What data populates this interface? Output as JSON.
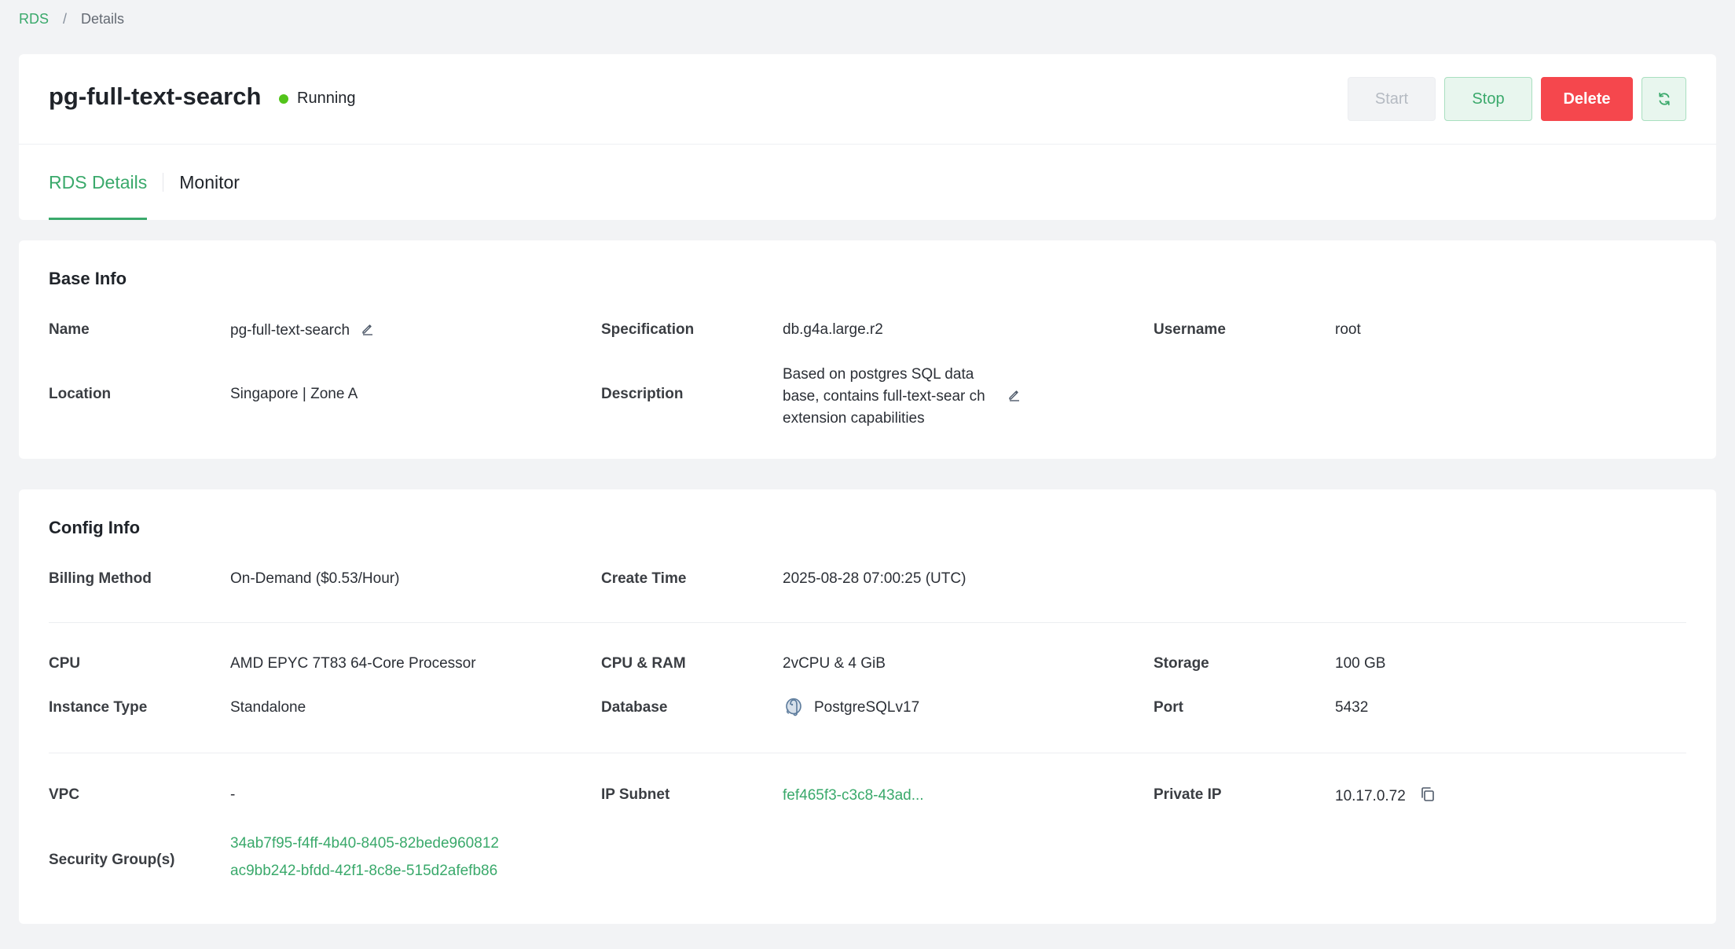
{
  "breadcrumb": {
    "root": "RDS",
    "separator": "/",
    "current": "Details"
  },
  "header": {
    "title": "pg-full-text-search",
    "status": "Running",
    "status_color": "#52c41a",
    "buttons": {
      "start": "Start",
      "stop": "Stop",
      "delete": "Delete",
      "refresh_icon": "refresh-icon"
    }
  },
  "tabs": [
    {
      "label": "RDS Details",
      "active": true
    },
    {
      "label": "Monitor",
      "active": false
    }
  ],
  "base_info": {
    "title": "Base Info",
    "name_label": "Name",
    "name_value": "pg-full-text-search",
    "spec_label": "Specification",
    "spec_value": "db.g4a.large.r2",
    "username_label": "Username",
    "username_value": "root",
    "location_label": "Location",
    "location_value": "Singapore | Zone A",
    "description_label": "Description",
    "description_value": "Based on postgres SQL data base, contains full-text-sear ch extension capabilities"
  },
  "config_info": {
    "title": "Config Info",
    "billing_label": "Billing Method",
    "billing_value": "On-Demand ($0.53/Hour)",
    "create_time_label": "Create Time",
    "create_time_value": "2025-08-28 07:00:25 (UTC)",
    "cpu_label": "CPU",
    "cpu_value": "AMD EPYC 7T83 64-Core Processor",
    "cpu_ram_label": "CPU & RAM",
    "cpu_ram_value": "2vCPU & 4 GiB",
    "storage_label": "Storage",
    "storage_value": "100 GB",
    "instance_type_label": "Instance Type",
    "instance_type_value": "Standalone",
    "database_label": "Database",
    "database_value": "PostgreSQLv17",
    "port_label": "Port",
    "port_value": "5432",
    "vpc_label": "VPC",
    "vpc_value": "-",
    "ip_subnet_label": "IP Subnet",
    "ip_subnet_value": "fef465f3-c3c8-43ad...",
    "private_ip_label": "Private IP",
    "private_ip_value": "10.17.0.72",
    "security_groups_label": "Security Group(s)",
    "security_groups": [
      "34ab7f95-f4ff-4b40-8405-82bede960812",
      "ac9bb242-bfdd-42f1-8c8e-515d2afefb86"
    ]
  },
  "colors": {
    "accent": "#3aa96b",
    "danger": "#f5474d",
    "background": "#f2f3f5"
  }
}
